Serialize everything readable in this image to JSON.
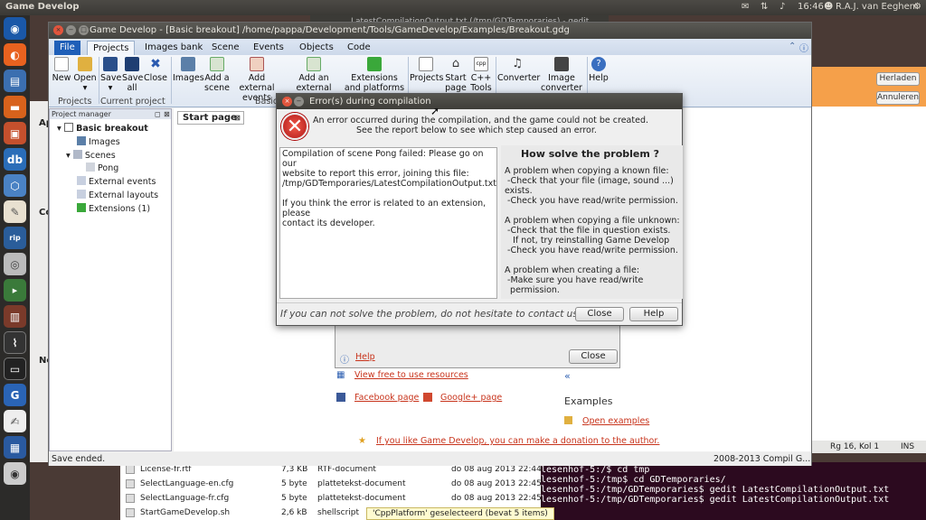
{
  "topbar": {
    "app_name": "Game Develop",
    "time": "16:46",
    "user": "R.A.J. van Eeghem"
  },
  "launcher": {
    "items": [
      "ubuntu-logo",
      "firefox",
      "files",
      "folder",
      "image-viewer",
      "virtualbox",
      "db",
      "box",
      "brush",
      "rip",
      "disc",
      "vlc",
      "books",
      "system-monitor",
      "terminal",
      "game-develop",
      "gedit",
      "desktop",
      "disc-2"
    ]
  },
  "background": {
    "right_buttons": [
      "Herladen",
      "Annuleren"
    ],
    "right_status": "Rg 16, Kol 1",
    "right_status_ins": "INS",
    "gedit_title": "LatestCompilationOutput.txt (/tmp/GDTemporaries) - gedit",
    "files": [
      {
        "name": "License-fr.rtf",
        "size": "7,3 KB",
        "type": "RTF-document",
        "date": "do 08 aug 2013 22:44:56"
      },
      {
        "name": "SelectLanguage-en.cfg",
        "size": "5 byte",
        "type": "plattetekst-document",
        "date": "do 08 aug 2013 22:45:06"
      },
      {
        "name": "SelectLanguage-fr.cfg",
        "size": "5 byte",
        "type": "plattetekst-document",
        "date": "do 08 aug 2013 22:45:06"
      },
      {
        "name": "StartGameDevelop.sh",
        "size": "2,6 kB",
        "type": "shellscript",
        "date": "do 08 aug 2013 22:45:06"
      }
    ],
    "selection_status": "'CppPlatform' geselecteerd (bevat 5 items)",
    "terminal_lines": [
      "lesenhof-5:/$ cd tmp",
      "lesenhof-5:/tmp$ cd GDTemporaries/",
      "lesenhof-5:/tmp/GDTemporaries$ gedit LatestCompilationOutput.txt",
      "lesenhof-5:/tmp/GDTemporaries$ gedit LatestCompilationOutput.txt"
    ],
    "left_slice": [
      "Ap",
      "Co",
      "Ne"
    ]
  },
  "mainwin": {
    "title": "Game Develop - [Basic breakout] /home/pappa/Development/Tools/GameDevelop/Examples/Breakout.gdg",
    "tabs": [
      "File",
      "Projects",
      "Images bank",
      "Scene",
      "Events",
      "Objects",
      "Code"
    ],
    "ribbon": {
      "new": "New",
      "open": "Open",
      "save": "Save",
      "save_all": "Save all",
      "close": "Close",
      "images": "Images",
      "add_scene": "Add a scene",
      "add_ext_events": "Add external events",
      "add_ext_layout": "Add an external layout",
      "extensions": "Extensions and platforms",
      "projects": "Projects",
      "start_page": "Start page",
      "cpp_tools": "C++ Tools",
      "converter": "Converter",
      "image_converter": "Image converter",
      "help": "Help",
      "grp_projects": "Projects",
      "grp_current": "Current project",
      "grp_basic": "Basic"
    },
    "pm": {
      "header": "Project manager",
      "root": "Basic breakout",
      "images": "Images",
      "scenes": "Scenes",
      "pong": "Pong",
      "ext_events": "External events",
      "ext_layouts": "External layouts",
      "extensions": "Extensions (1)"
    },
    "start_tab": "Start page",
    "links": {
      "help": "Help",
      "close": "Close",
      "free_res": "View free to use resources",
      "fb": "Facebook page",
      "gplus": "Google+ page",
      "examples_head": "Examples",
      "open_examples": "Open examples",
      "donate": "If you like Game Develop, you can make a donation to the author.",
      "arrow": "«"
    },
    "status": "Save ended.",
    "copyright": "2008-2013 Compil G..."
  },
  "error": {
    "title": "Error(s) during compilation",
    "msg1": "An error occurred during the compilation, and the game could not be created.",
    "msg2": "See the report below to see which step caused an error.",
    "report": "Compilation of scene Pong failed: Please go on our\nwebsite to report this error, joining this file:\n/tmp/GDTemporaries/LatestCompilationOutput.txt\n\nIf you think the error is related to an extension, please\ncontact its developer.",
    "how_title": "How solve the problem ?",
    "how_body": "A problem when copying a known file:\n -Check that your file (image, sound ...) exists.\n -Check you have read/write permission.\n\nA problem when copying a file unknown:\n -Check that the file in question exists.\n   If not, try reinstalling Game Develop\n -Check you have read/write permission.\n\nA problem when creating a file:\n -Make sure you have read/write\n  permission.",
    "footer": "If you can not solve the problem, do not hesitate to contact us",
    "close": "Close",
    "help": "Help"
  },
  "colors": {
    "ribbon": "#dfe7f2",
    "link": "#c8341c",
    "terminal": "#2c0a1f",
    "accent_orange": "#f5a04a"
  }
}
